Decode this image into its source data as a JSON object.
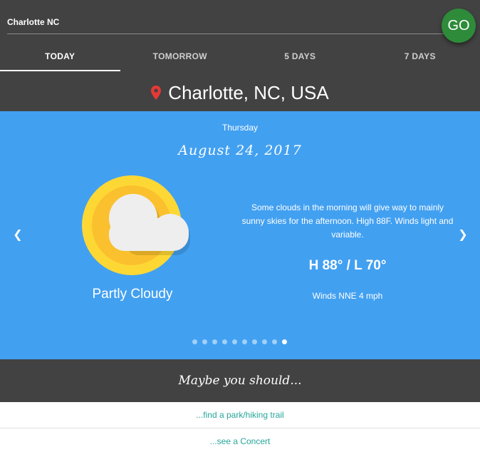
{
  "search": {
    "value": "Charlotte NC",
    "go_label": "GO"
  },
  "tabs": [
    {
      "label": "TODAY",
      "active": true
    },
    {
      "label": "TOMORROW",
      "active": false
    },
    {
      "label": "5 DAYS",
      "active": false
    },
    {
      "label": "7 DAYS",
      "active": false
    }
  ],
  "location": {
    "name": "Charlotte, NC, USA",
    "icon": "map-pin-icon",
    "icon_color": "#e53935"
  },
  "forecast": {
    "day": "Thursday",
    "date": "August 24, 2017",
    "icon": "partly-cloudy-icon",
    "condition": "Partly Cloudy",
    "description": "Some clouds in the morning will give way to mainly sunny skies for the afternoon. High 88F. Winds light and variable.",
    "temps": "H 88° / L 70°",
    "winds": "Winds NNE 4 mph",
    "background_color": "#42a0f1"
  },
  "carousel": {
    "total": 10,
    "active_index": 9,
    "prev_icon": "chevron-left-icon",
    "next_icon": "chevron-right-icon"
  },
  "suggestions": {
    "title": "Maybe you should...",
    "items": [
      "...find a park/hiking trail",
      "...see a Concert"
    ]
  },
  "colors": {
    "header_bg": "#424242",
    "go_button": "#2e8b3a",
    "link": "#26a69a"
  }
}
